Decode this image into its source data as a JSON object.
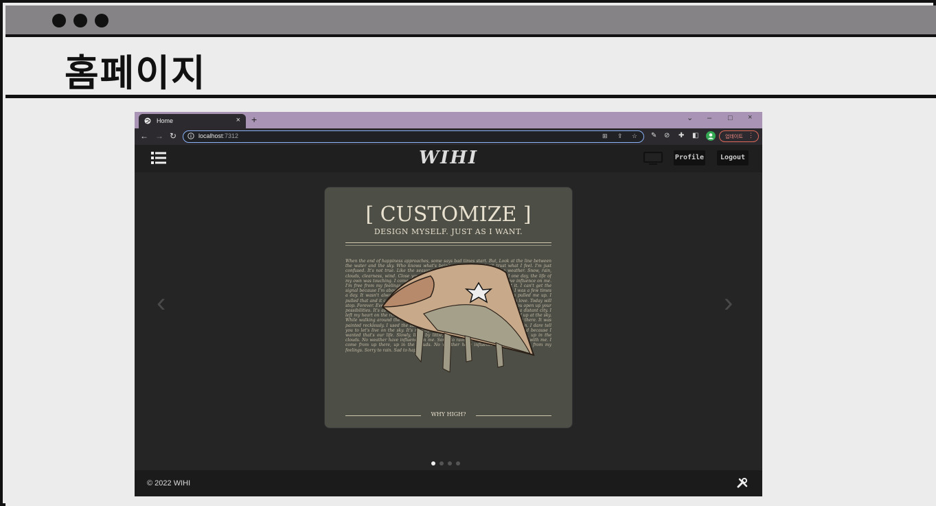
{
  "page": {
    "title": "홈페이지"
  },
  "browser": {
    "tab_title": "Home",
    "tab_close": "×",
    "new_tab": "+",
    "window_controls": {
      "minimize": "–",
      "maximize": "□",
      "close": "×",
      "dropdown": "⌄"
    },
    "url_host": "localhost",
    "url_port": ":7312",
    "update_label": "업데이트",
    "update_menu": "⋮"
  },
  "site": {
    "logo": "WIHI",
    "profile_label": "Profile",
    "logout_label": "Logout",
    "copyright": "© 2022 WIHI"
  },
  "slide": {
    "title": "[ CUSTOMIZE ]",
    "subtitle": "DESIGN MYSELF. JUST AS I WANT.",
    "body_text": "When the end of happiness approaches, some says bad times start. But, Look at the line between the water and the sky. Who knows what's being somewhere. I don't trust what I feel. I'm just confused. It's not true. Like the seasons refresh, we already know all the weather. Snow, rain, clouds, clearness, wind. Close your eyes and greet everyone. Just feel it and one day, the life of my own was touching. I come from up there, up in the clouds. No weather have influence on me. I'm free from my feelings. Sorry to rain. Sad to happy. I'm sorry I didn't get it. I can't get the signal because I'm above the clouds. Since when have you been here? Actually, I was a few times a day. It wasn't always like that. One day, my body suddenly floated. The sun pulled me up. I pulled that and it came here. I don't have any shoes. Don't you think it's so much love. Today will stop. Forever. Every thing is united. I'll wait for you indefinitely. Anytime I hope you open up your possibilities. It's as soft as whipped cream. Let's live what The sky is closer than a distant city. I left my heart on the road. I learned to fly things piled up in a ground. Dusty looked up at the sky. While walking around the wheel, I and there. And the place I'm going to be is near there. It was painted recklessly. I used the same color. Black went away after washing in the rain. I dare tell you to let's live on the sky. It's raining. Make a time-line when you want. I changed because I wanted that's our life. Slowly, little by little, the difference. I came from up there, up in the clouds. No weather have influence on me. Sorry to rain. Sad to happy. Nothing to do with me. I come from up there, up in the clouds. No weather have influence on me. I'm free from my feelings. Sorry to rain. Sad to happy.",
    "footer": "WHY HIGH?"
  }
}
